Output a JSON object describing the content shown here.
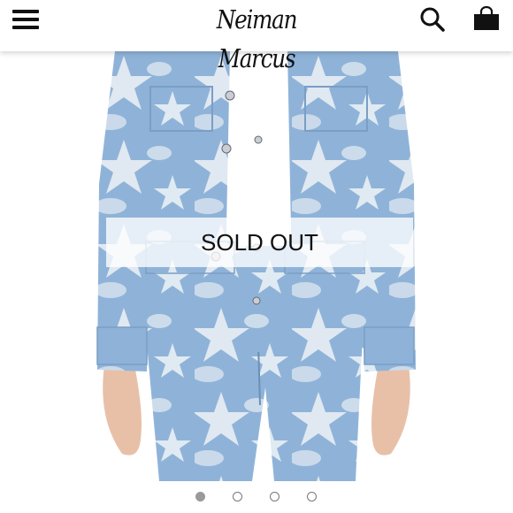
{
  "header": {
    "brand": "Neiman Marcus",
    "menu_icon": "hamburger-menu-icon",
    "search_icon": "search-icon",
    "bag_icon": "shopping-bag-icon"
  },
  "product": {
    "status_banner": "SOLD OUT",
    "carousel": {
      "total_images": 4,
      "active_index": 1
    }
  },
  "colors": {
    "denim": "#8fb3d8",
    "bleach": "#e9eef4",
    "skin": "#e8c0a8",
    "header_bg": "#ffffff",
    "dot_active": "#9a9a9a"
  }
}
